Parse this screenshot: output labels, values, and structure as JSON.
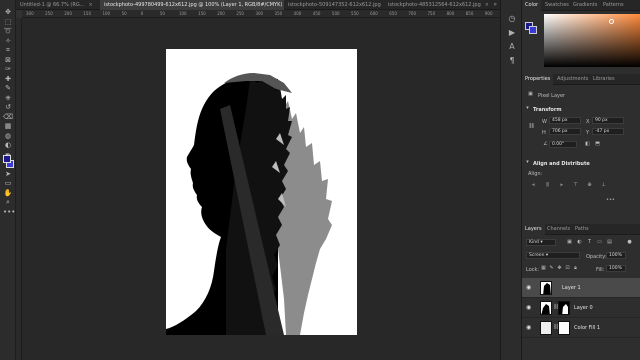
{
  "document_tabs": [
    {
      "label": "Untitled-1 @ 66.7% (RG...",
      "active": false
    },
    {
      "label": "istockphoto-499780499-612x612.jpg @ 100% (Layer 1, RGB/8#/CMYK)",
      "active": true
    },
    {
      "label": "istockphoto-509147352-612x612.jpg",
      "active": false
    },
    {
      "label": "istockphoto-485312564-612x612.jpg",
      "active": false
    }
  ],
  "tab_close": "×",
  "tab_overflow": "»",
  "ruler_ticks": [
    "300",
    "250",
    "200",
    "150",
    "100",
    "50",
    "0",
    "50",
    "100",
    "150",
    "200",
    "250",
    "300",
    "350",
    "400",
    "450",
    "500",
    "550",
    "600",
    "650",
    "700",
    "750",
    "800",
    "850",
    "900"
  ],
  "tool_icons": [
    "move-icon",
    "marquee-icon",
    "lasso-icon",
    "quick-select-icon",
    "crop-icon",
    "frame-icon",
    "eyedropper-icon",
    "healing-brush-icon",
    "brush-icon",
    "clone-stamp-icon",
    "history-brush-icon",
    "eraser-icon",
    "gradient-icon",
    "blur-icon",
    "dodge-icon",
    "pen-icon",
    "type-icon",
    "path-select-icon",
    "rectangle-icon",
    "hand-icon",
    "zoom-icon",
    "more-tools-icon"
  ],
  "color_panel": {
    "tabs": [
      "Color",
      "Swatches",
      "Gradients",
      "Patterns"
    ],
    "foreground": "#1a1a8c",
    "background": "#3a3ad8",
    "picked": "#ff8a3a"
  },
  "properties_panel": {
    "tabs": [
      "Properties",
      "Adjustments",
      "Libraries"
    ],
    "layer_type": "Pixel Layer",
    "transform_title": "Transform",
    "w_label": "W",
    "w_value": "458 px",
    "h_label": "H",
    "h_value": "706 px",
    "x_label": "X",
    "x_value": "90 px",
    "y_label": "Y",
    "y_value": "-47 px",
    "angle_value": "0.00°",
    "align_title": "Align and Distribute",
    "align_label": "Align:",
    "more": "•••"
  },
  "layers_panel": {
    "tabs": [
      "Layers",
      "Channels",
      "Paths"
    ],
    "kind_label": "Kind",
    "blend_mode": "Screen",
    "opacity_label": "Opacity:",
    "opacity_value": "100%",
    "lock_label": "Lock:",
    "fill_label": "Fill:",
    "fill_value": "100%",
    "layers": [
      {
        "name": "Layer 1",
        "selected": true
      },
      {
        "name": "Layer 0",
        "selected": false
      },
      {
        "name": "Color Fill 1",
        "selected": false
      }
    ]
  },
  "colors": {
    "canvas_bg": "#282828",
    "silhouette": "#000000",
    "forest_gray": "#8c8c8c",
    "selection": "#4a4a4a"
  }
}
